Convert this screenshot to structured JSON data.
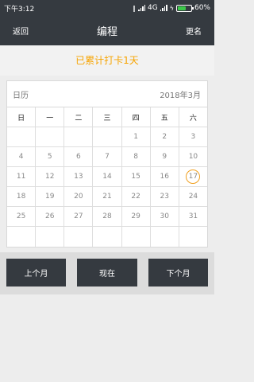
{
  "status_bar": {
    "time": "下午3:12",
    "network": "4G",
    "battery_percent": "60%",
    "battery_level": 0.6,
    "battery_color": "#3cc84a",
    "icons": [
      "vibrate-icon",
      "signal-icon",
      "charging-icon",
      "battery-icon"
    ]
  },
  "nav": {
    "back_label": "返回",
    "title": "编程",
    "rename_label": "更名"
  },
  "streak": {
    "text": "已累计打卡1天",
    "color": "#f7a400"
  },
  "calendar": {
    "label": "日历",
    "month": "2018年3月",
    "weekdays": [
      "日",
      "一",
      "二",
      "三",
      "四",
      "五",
      "六"
    ],
    "weeks": [
      [
        "",
        "",
        "",
        "",
        "1",
        "2",
        "3"
      ],
      [
        "4",
        "5",
        "6",
        "7",
        "8",
        "9",
        "10"
      ],
      [
        "11",
        "12",
        "13",
        "14",
        "15",
        "16",
        "17"
      ],
      [
        "18",
        "19",
        "20",
        "21",
        "22",
        "23",
        "24"
      ],
      [
        "25",
        "26",
        "27",
        "28",
        "29",
        "30",
        "31"
      ],
      [
        "",
        "",
        "",
        "",
        "",
        "",
        ""
      ]
    ],
    "today": "17",
    "today_ring_color": "#f0a020"
  },
  "buttons": {
    "prev_label": "上个月",
    "now_label": "现在",
    "next_label": "下个月"
  }
}
